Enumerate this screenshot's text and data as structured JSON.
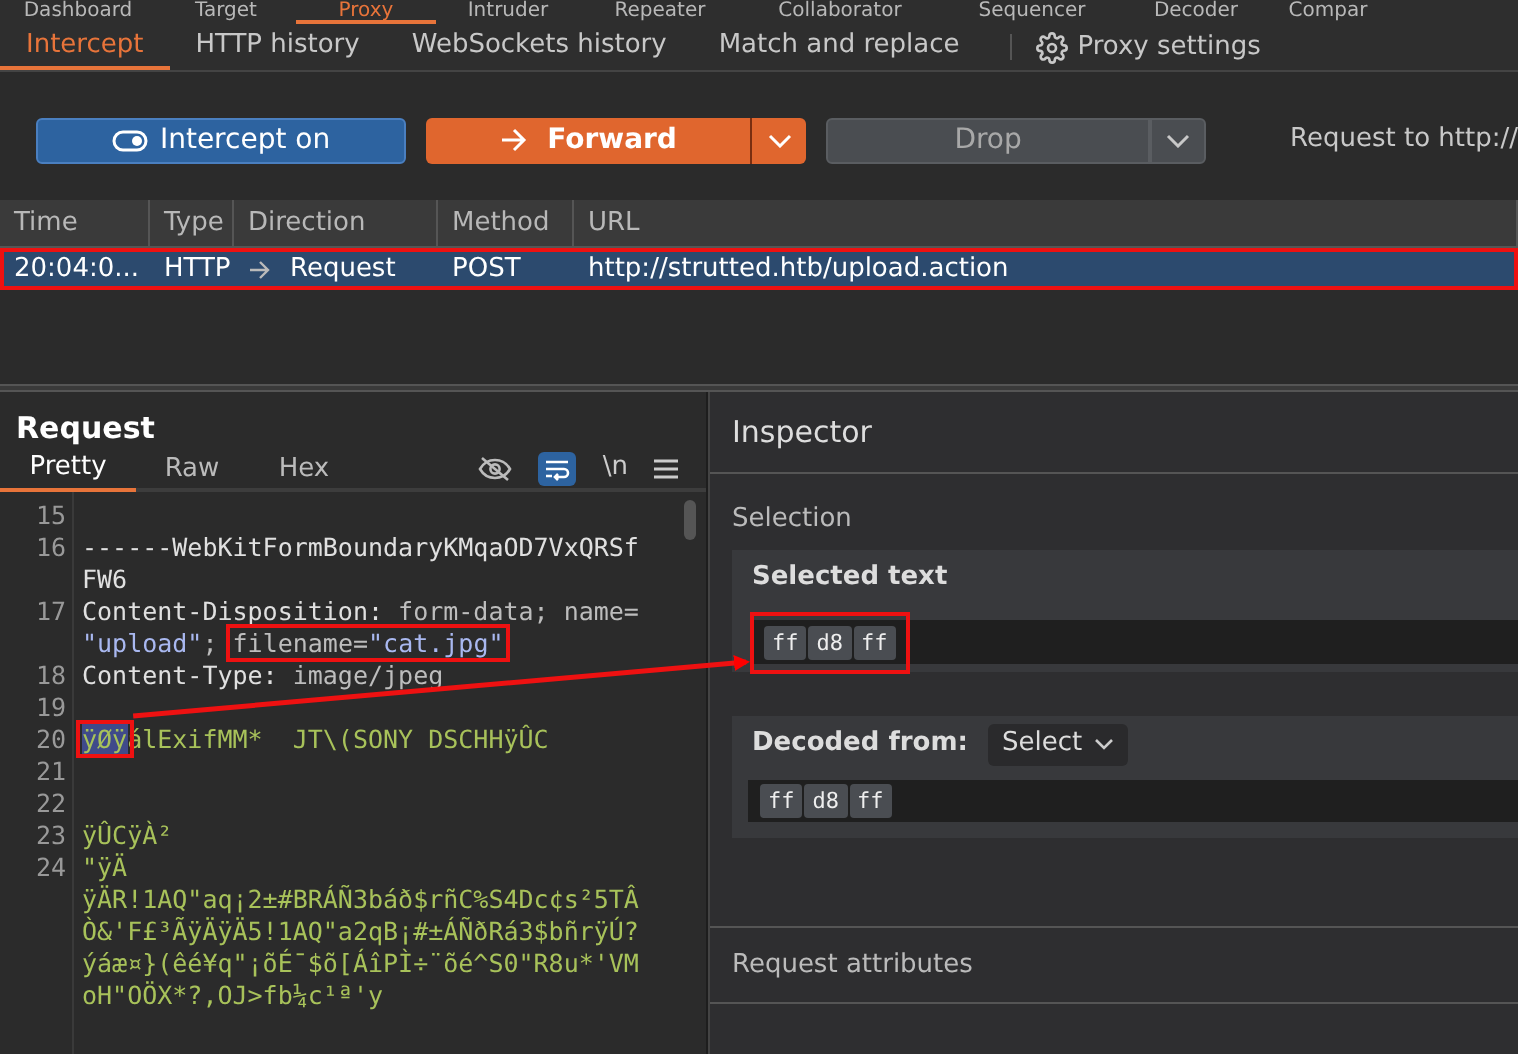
{
  "tool_tabs": [
    {
      "label": "Dashboard",
      "selected": false
    },
    {
      "label": "Target",
      "selected": false
    },
    {
      "label": "Proxy",
      "selected": true
    },
    {
      "label": "Intruder",
      "selected": false
    },
    {
      "label": "Repeater",
      "selected": false
    },
    {
      "label": "Collaborator",
      "selected": false
    },
    {
      "label": "Sequencer",
      "selected": false
    },
    {
      "label": "Decoder",
      "selected": false
    },
    {
      "label": "Compar",
      "selected": false
    }
  ],
  "proxy_tabs": [
    {
      "label": "Intercept",
      "selected": true
    },
    {
      "label": "HTTP history",
      "selected": false
    },
    {
      "label": "WebSockets history",
      "selected": false
    },
    {
      "label": "Match and replace",
      "selected": false
    }
  ],
  "proxy_settings": "Proxy settings",
  "toolbar": {
    "intercept": {
      "label": "Intercept on",
      "on": true
    },
    "forward": "Forward",
    "drop": "Drop",
    "request_to": "Request to http://"
  },
  "table": {
    "columns": [
      "Time",
      "Type",
      "Direction",
      "Method",
      "URL"
    ],
    "rows": [
      {
        "selected": true,
        "boxed": true,
        "cells": [
          "20:04:0...",
          "HTTP",
          "Request",
          "POST",
          "http://strutted.htb/upload.action"
        ]
      }
    ]
  },
  "request": {
    "title": "Request",
    "tabs": [
      {
        "label": "Pretty",
        "selected": true
      },
      {
        "label": "Raw",
        "selected": false
      },
      {
        "label": "Hex",
        "selected": false
      }
    ],
    "newline_toggle": "\\n",
    "lines": [
      {
        "number": "15",
        "rows": [
          {
            "spans": []
          }
        ]
      },
      {
        "number": "16",
        "rows": [
          {
            "spans": [
              {
                "kind": "key",
                "text": "------WebKitFormBoundaryKMqaOD7VxQRSf"
              }
            ]
          },
          {
            "spans": [
              {
                "kind": "key",
                "text": "FW6"
              }
            ]
          }
        ]
      },
      {
        "number": "17",
        "rows": [
          {
            "spans": [
              {
                "kind": "key",
                "text": "Content-Disposition: "
              },
              {
                "kind": "plain",
                "text": "form-data; name="
              }
            ]
          },
          {
            "spans": [
              {
                "kind": "string",
                "text": "\"upload\""
              },
              {
                "kind": "plain",
                "text": "; "
              },
              {
                "kind": "plain",
                "text": "filename=",
                "boxed": true
              },
              {
                "kind": "string",
                "text": "\"cat.jpg\"",
                "boxed": true
              }
            ]
          }
        ]
      },
      {
        "number": "18",
        "rows": [
          {
            "spans": [
              {
                "kind": "key",
                "text": "Content-Type: "
              },
              {
                "kind": "plain",
                "text": "image/jpeg"
              }
            ]
          }
        ]
      },
      {
        "number": "19",
        "rows": [
          {
            "spans": []
          }
        ]
      },
      {
        "number": "20",
        "rows": [
          {
            "spans": [
              {
                "kind": "selected",
                "text": "ÿØÿ",
                "boxed": true
              },
              {
                "kind": "body",
                "text": "álExifMM*  JT\\(SONY DSCHHÿÛC"
              }
            ]
          }
        ]
      },
      {
        "number": "21",
        "rows": [
          {
            "spans": []
          }
        ]
      },
      {
        "number": "22",
        "rows": [
          {
            "spans": []
          }
        ]
      },
      {
        "number": "23",
        "rows": [
          {
            "spans": [
              {
                "kind": "body",
                "text": "ÿÛCÿÀ²"
              }
            ]
          }
        ]
      },
      {
        "number": "24",
        "rows": [
          {
            "spans": [
              {
                "kind": "body",
                "text": "\"ÿÄ"
              }
            ]
          },
          {
            "spans": [
              {
                "kind": "body",
                "text": "ÿÄR!1AQ\"aq¡2±#BRÁÑ3báð$rñC%S4Dc¢s²5TÂ"
              }
            ]
          },
          {
            "spans": [
              {
                "kind": "body",
                "text": "Ò&'F£³ÃÿÄÿÄ5!1AQ\"a2qB¡#±ÁÑðRá3$bñrÿÚ?"
              }
            ]
          },
          {
            "spans": [
              {
                "kind": "body",
                "text": "ýáæ¤}(êé¥q\"¡õÉ¯$õ[ÁîPÌ÷¨õé^S0\"R8u*'VM"
              }
            ]
          },
          {
            "spans": [
              {
                "kind": "body",
                "text": "oH\"OÖX*?,OJ>fb¼c¹ª'y"
              }
            ]
          }
        ]
      }
    ]
  },
  "inspector": {
    "title": "Inspector",
    "section": "Selection",
    "selected_text": {
      "title": "Selected text",
      "boxed": true,
      "bytes": [
        "ff",
        "d8",
        "ff"
      ]
    },
    "decoded_from": {
      "label": "Decoded from:",
      "select": "Select",
      "bytes": [
        "ff",
        "d8",
        "ff"
      ]
    },
    "request_attributes": "Request attributes"
  }
}
